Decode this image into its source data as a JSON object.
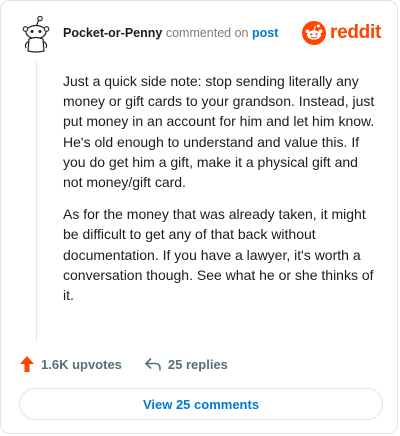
{
  "comment": {
    "username": "Pocket-or-Penny",
    "commented_text": "commented on",
    "post_link": "post",
    "body": [
      "Just a quick side note: stop sending literally any money or gift cards to your grandson. Instead, just put money in an account for him and let him know. He's old enough to understand and value this. If you do get him a gift, make it a physical gift and not money/gift card.",
      "As for the money that was already taken, it might be difficult to get any of that back without documentation. If you have a lawyer, it's worth a conversation though. See what he or she thinks of it."
    ]
  },
  "brand": {
    "name": "reddit",
    "color": "#ff4500",
    "icon": "reddit-logo-icon"
  },
  "actions": {
    "upvotes": "1.6K upvotes",
    "replies": "25 replies",
    "upvote_icon": "upvote-arrow-icon",
    "reply_icon": "reply-arrow-icon",
    "upvote_color": "#ff4500"
  },
  "view_button": {
    "label": "View 25 comments"
  },
  "colors": {
    "link": "#0079d3",
    "meta": "#7c7c7c",
    "action": "#576f76"
  }
}
